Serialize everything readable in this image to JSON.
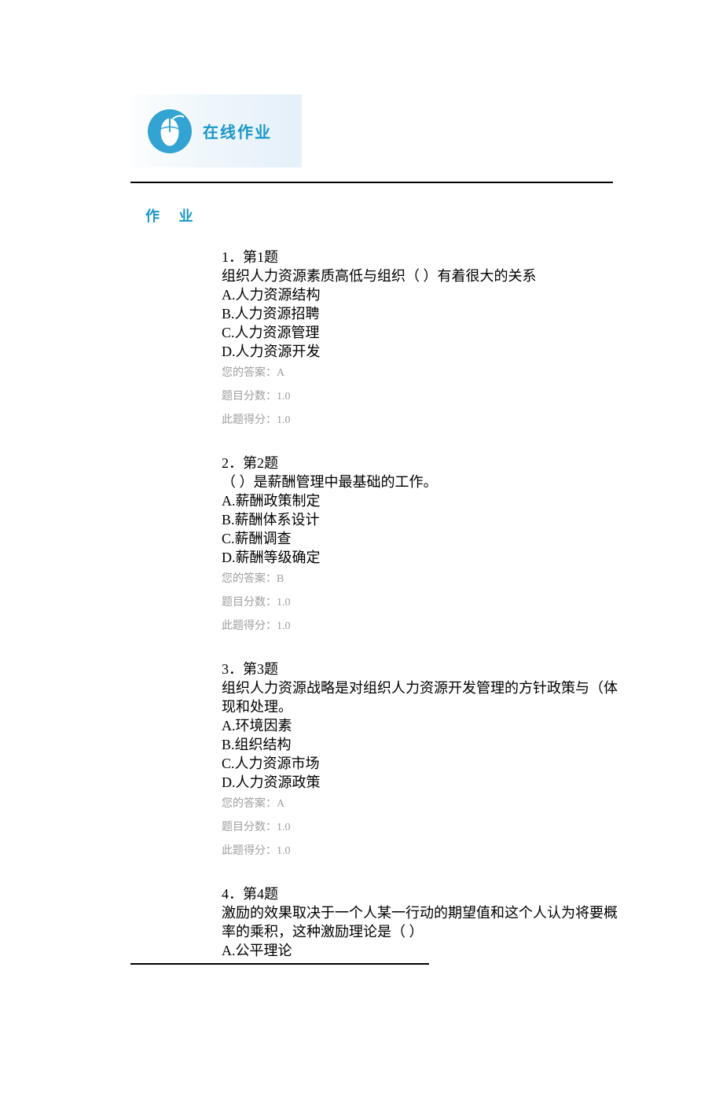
{
  "header": {
    "title": "在线作业"
  },
  "section_label": "作 业",
  "questions": [
    {
      "number": "1．第1题",
      "prompt": "组织人力资源素质高低与组织（ ）有着很大的关系",
      "options": [
        "A.人力资源结构",
        "B.人力资源招聘",
        "C.人力资源管理",
        "D.人力资源开发"
      ],
      "answer_label": "您的答案：",
      "answer": "A",
      "points_label": "题目分数：",
      "points": "1.0",
      "score_label": "此题得分：",
      "score": "1.0"
    },
    {
      "number": "2．第2题",
      "prompt": "（ ）是薪酬管理中最基础的工作。",
      "options": [
        "A.薪酬政策制定",
        "B.薪酬体系设计",
        "C.薪酬调查",
        "D.薪酬等级确定"
      ],
      "answer_label": "您的答案：",
      "answer": "B",
      "points_label": "题目分数：",
      "points": "1.0",
      "score_label": "此题得分：",
      "score": "1.0"
    },
    {
      "number": "3．第3题",
      "prompt": "组织人力资源战略是对组织人力资源开发管理的方针政策与（体现和处理。",
      "options": [
        "A.环境因素",
        "B.组织结构",
        "C.人力资源市场",
        "D.人力资源政策"
      ],
      "answer_label": "您的答案：",
      "answer": "A",
      "points_label": "题目分数：",
      "points": "1.0",
      "score_label": "此题得分：",
      "score": "1.0"
    },
    {
      "number": "4．第4题",
      "prompt": "激励的效果取决于一个人某一行动的期望值和这个人认为将要概率的乘积，这种激励理论是（ ）",
      "options": [
        "A.公平理论"
      ],
      "answer_label": "",
      "answer": "",
      "points_label": "",
      "points": "",
      "score_label": "",
      "score": ""
    }
  ]
}
